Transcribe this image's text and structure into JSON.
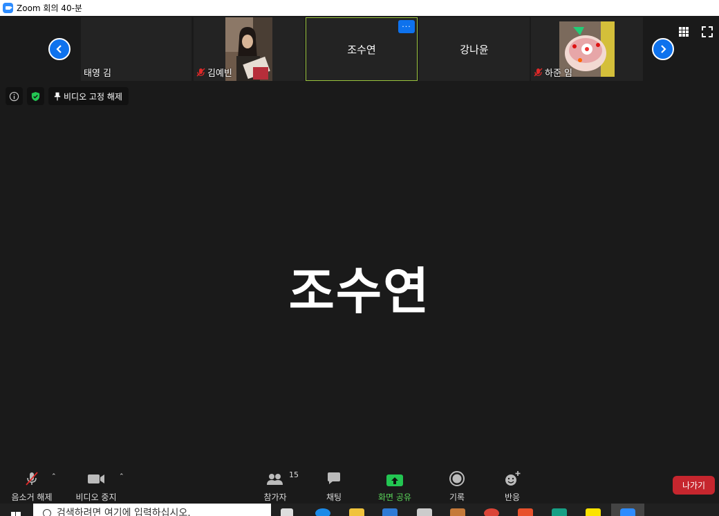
{
  "window": {
    "title": "Zoom 회의 40-분"
  },
  "participants": [
    {
      "name": "태영 김",
      "muted": false,
      "video": false
    },
    {
      "name": "김예빈",
      "muted": true,
      "video": true
    },
    {
      "name": "조수연",
      "muted": false,
      "video": false,
      "active": true,
      "more_label": "···"
    },
    {
      "name": "강나윤",
      "muted": false,
      "video": false
    },
    {
      "name": "하준 임",
      "muted": true,
      "video": true
    }
  ],
  "controls": {
    "unpin_label": "비디오 고정 해제"
  },
  "speaker": {
    "name": "조수연"
  },
  "toolbar": {
    "unmute_label": "음소거 해제",
    "stop_video_label": "비디오 중지",
    "participants_label": "참가자",
    "participants_count": "15",
    "chat_label": "채팅",
    "share_label": "화면 공유",
    "record_label": "기록",
    "reactions_label": "반응",
    "leave_label": "나가기"
  },
  "taskbar": {
    "search_placeholder": "검색하려면 여기에 입력하십시오."
  },
  "colors": {
    "accent": "#0e72ed",
    "active_border": "#9bc53d",
    "leave": "#c6262e",
    "share": "#23c552"
  }
}
